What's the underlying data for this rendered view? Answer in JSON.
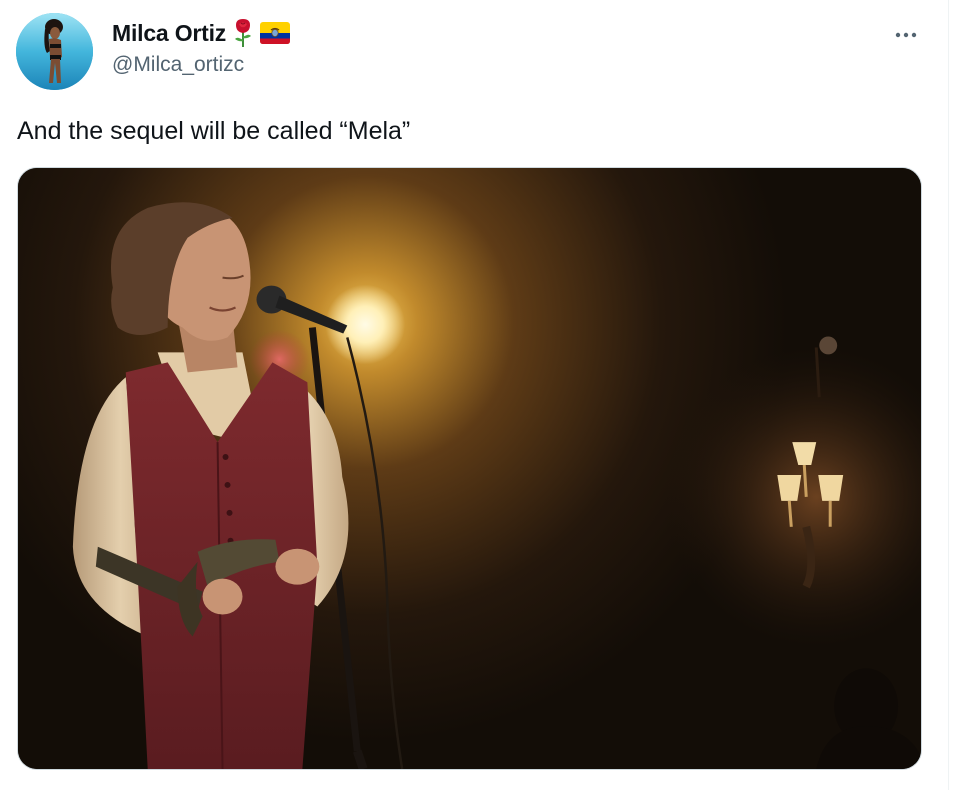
{
  "tweet": {
    "author": {
      "display_name": "Milca Ortiz",
      "handle": "@Milca_ortizc",
      "badges": [
        "rose-emoji",
        "ecuador-flag-emoji"
      ],
      "avatar_icon": "profile-avatar"
    },
    "more_icon": "more-horizontal-icon",
    "text": "And the sequel will be called “Mela”",
    "media": {
      "type": "photo",
      "icon": "photo-image"
    }
  },
  "colors": {
    "primary_text": "#0f1419",
    "secondary_text": "#536471",
    "border": "#cfd9de",
    "background": "#ffffff"
  }
}
